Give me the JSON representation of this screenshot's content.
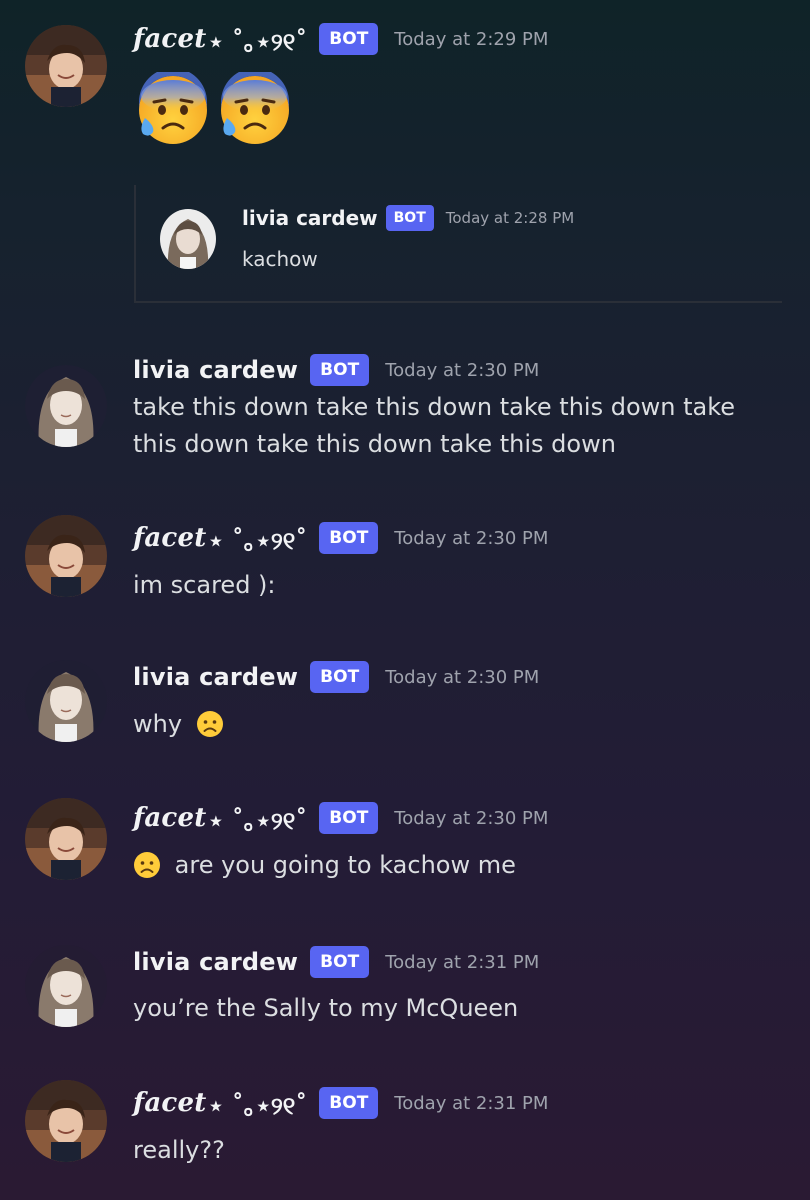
{
  "bot_badge": "BOT",
  "users": {
    "facet": {
      "name": "facet",
      "deco": "⋆ ˚｡⋆୨୧˚"
    },
    "livia": {
      "name": "livia cardew"
    }
  },
  "messages": [
    {
      "author": "facet ⋆ ˚｡⋆୨୧˚",
      "time": "Today at 2:29 PM",
      "emojis": [
        "anxious-face-with-sweat",
        "anxious-face-with-sweat"
      ]
    },
    {
      "author": "livia cardew",
      "time": "Today at 2:28 PM",
      "text": "kachow",
      "embedded": true
    },
    {
      "author": "livia cardew",
      "time": "Today at 2:30 PM",
      "text": "take this down take this down take this down take this down take this down take this down"
    },
    {
      "author": "facet ⋆ ˚｡⋆୨୧˚",
      "time": "Today at 2:30 PM",
      "text": "im scared ):"
    },
    {
      "author": "livia cardew",
      "time": "Today at 2:30 PM",
      "text": "why",
      "emoji_after": "frowning-face"
    },
    {
      "author": "facet ⋆ ˚｡⋆୨୧˚",
      "time": "Today at 2:30 PM",
      "text": "are you going to kachow me",
      "emoji_before": "frowning-face"
    },
    {
      "author": "livia cardew",
      "time": "Today at 2:31 PM",
      "text": "you’re the Sally to my McQueen"
    },
    {
      "author": "facet ⋆ ˚｡⋆୨୧˚",
      "time": "Today at 2:31 PM",
      "text": "really??"
    }
  ],
  "colors": {
    "badge": "#5865f2",
    "timestamp": "#9fa3ad",
    "message_text": "#dbdee1"
  }
}
